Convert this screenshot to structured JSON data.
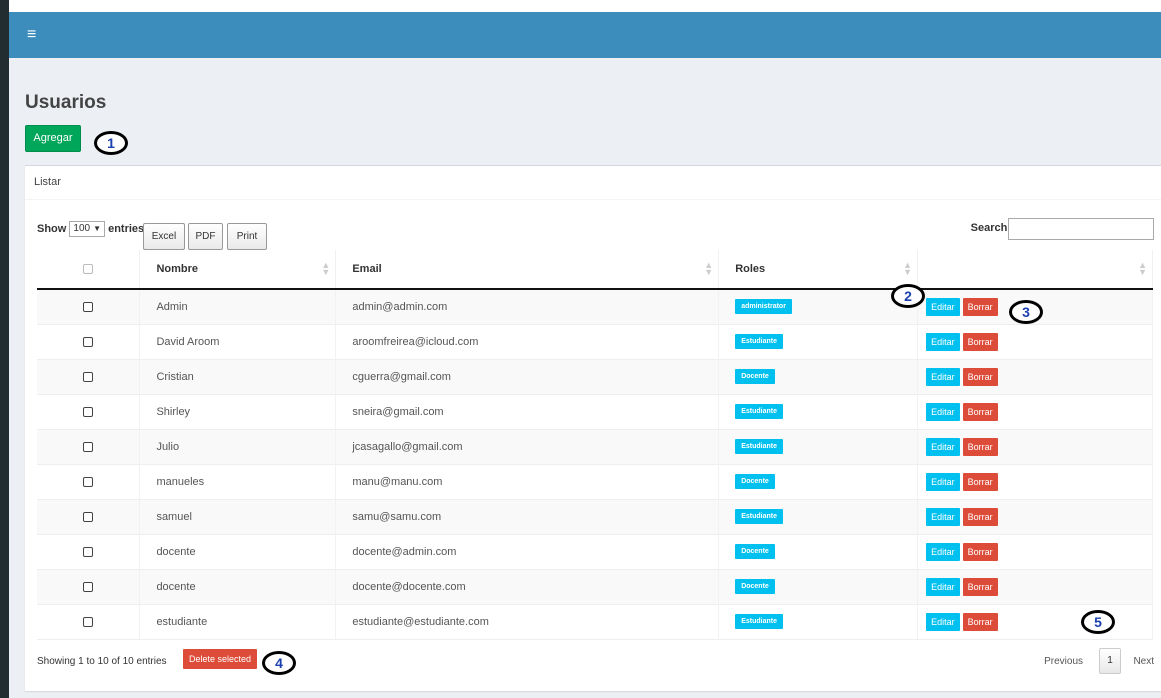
{
  "navbar": {
    "menu_icon": "hamburger-menu-icon",
    "menu_glyph": "≡",
    "color": "#3c8dbc"
  },
  "page": {
    "title": "Usuarios",
    "add_button": "Agregar"
  },
  "box": {
    "header": "Listar"
  },
  "table_controls": {
    "show_label": "Show",
    "entries_value": "100",
    "entries_label": "entries",
    "export_buttons": [
      "Excel",
      "PDF",
      "Print"
    ],
    "search_label": "Search:",
    "search_value": ""
  },
  "table": {
    "columns": [
      "",
      "Nombre",
      "Email",
      "Roles",
      ""
    ],
    "rows": [
      {
        "nombre": "Admin",
        "email": "admin@admin.com",
        "rol": "administrator"
      },
      {
        "nombre": "David Aroom",
        "email": "aroomfreirea@icloud.com",
        "rol": "Estudiante"
      },
      {
        "nombre": "Cristian",
        "email": "cguerra@gmail.com",
        "rol": "Docente"
      },
      {
        "nombre": "Shirley",
        "email": "sneira@gmail.com",
        "rol": "Estudiante"
      },
      {
        "nombre": "Julio",
        "email": "jcasagallo@gmail.com",
        "rol": "Estudiante"
      },
      {
        "nombre": "manueles",
        "email": "manu@manu.com",
        "rol": "Docente"
      },
      {
        "nombre": "samuel",
        "email": "samu@samu.com",
        "rol": "Estudiante"
      },
      {
        "nombre": "docente",
        "email": "docente@admin.com",
        "rol": "Docente"
      },
      {
        "nombre": "docente",
        "email": "docente@docente.com",
        "rol": "Docente"
      },
      {
        "nombre": "estudiante",
        "email": "estudiante@estudiante.com",
        "rol": "Estudiante"
      }
    ],
    "edit_label": "Editar",
    "delete_label": "Borrar"
  },
  "footer": {
    "info": "Showing 1 to 10 of 10 entries",
    "delete_selected": "Delete selected",
    "previous": "Previous",
    "page": "1",
    "next": "Next"
  },
  "callouts": [
    "1",
    "2",
    "3",
    "4",
    "5"
  ],
  "colors": {
    "green": "#00a65a",
    "info": "#00c0ef",
    "danger": "#dd4b39"
  }
}
